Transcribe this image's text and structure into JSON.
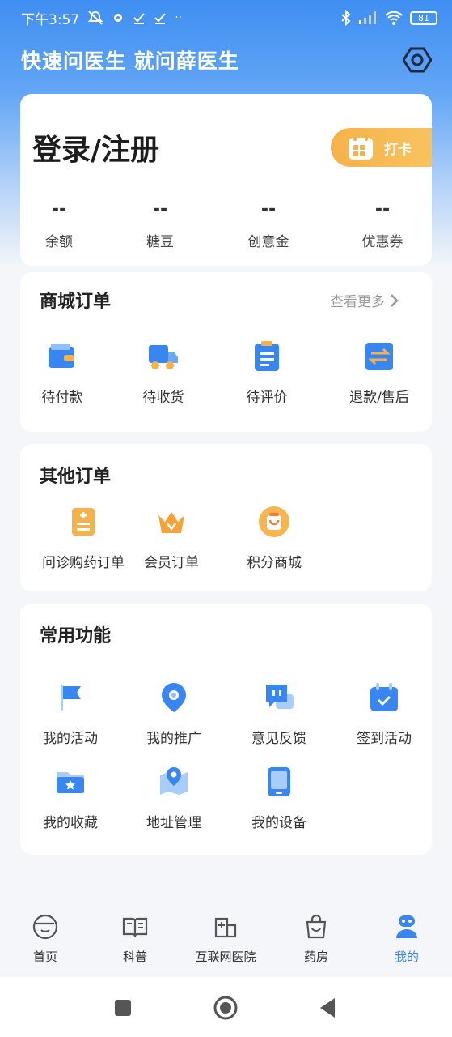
{
  "status_bar": {
    "time": "下午3:57",
    "battery": "81"
  },
  "header": {
    "slogan": "快速问医生 就问薛医生"
  },
  "login_card": {
    "title": "登录/注册",
    "checkin_label": "打卡",
    "stats": [
      {
        "value": "--",
        "label": "余额"
      },
      {
        "value": "--",
        "label": "糖豆"
      },
      {
        "value": "--",
        "label": "创意金"
      },
      {
        "value": "--",
        "label": "优惠券"
      }
    ]
  },
  "shop_orders": {
    "title": "商城订单",
    "more": "查看更多",
    "items": [
      {
        "label": "待付款",
        "icon": "wallet-icon"
      },
      {
        "label": "待收货",
        "icon": "truck-icon"
      },
      {
        "label": "待评价",
        "icon": "clipboard-icon"
      },
      {
        "label": "退款/售后",
        "icon": "refund-icon"
      }
    ]
  },
  "other_orders": {
    "title": "其他订单",
    "items": [
      {
        "label": "问诊购药订单",
        "icon": "consult-order-icon"
      },
      {
        "label": "会员订单",
        "icon": "crown-icon"
      },
      {
        "label": "积分商城",
        "icon": "points-mall-icon"
      }
    ]
  },
  "common_functions": {
    "title": "常用功能",
    "items": [
      {
        "label": "我的活动",
        "icon": "flag-icon"
      },
      {
        "label": "我的推广",
        "icon": "location-pin-icon"
      },
      {
        "label": "意见反馈",
        "icon": "feedback-icon"
      },
      {
        "label": "签到活动",
        "icon": "calendar-check-icon"
      },
      {
        "label": "我的收藏",
        "icon": "favorites-folder-icon"
      },
      {
        "label": "地址管理",
        "icon": "map-icon"
      },
      {
        "label": "我的设备",
        "icon": "tablet-icon"
      }
    ]
  },
  "tabbar": {
    "tabs": [
      {
        "label": "首页",
        "icon": "home-face-icon"
      },
      {
        "label": "科普",
        "icon": "book-icon"
      },
      {
        "label": "互联网医院",
        "icon": "hospital-icon"
      },
      {
        "label": "药房",
        "icon": "bag-icon"
      },
      {
        "label": "我的",
        "icon": "profile-robot-icon",
        "active": true
      }
    ]
  },
  "colors": {
    "primary": "#3a86f0",
    "checkin": "#f6b24a",
    "background": "#f4f6f9"
  }
}
